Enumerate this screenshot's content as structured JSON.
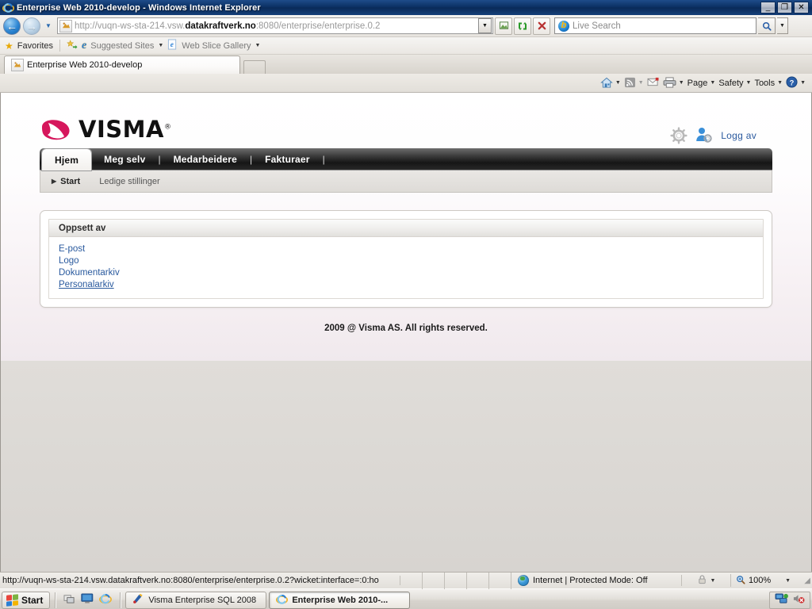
{
  "window": {
    "title": "Enterprise Web 2010-develop - Windows Internet Explorer",
    "minimize": "_",
    "restore": "❐",
    "close": "✕"
  },
  "browser": {
    "back_icon": "←",
    "forward_icon": "→",
    "recent_caret": "▼",
    "address": {
      "url_prefix": "http://vuqn-ws-sta-214.vsw.",
      "url_domain": "datakraftverk.no",
      "url_suffix": ":8080/enterprise/enterprise.0.2",
      "dropdown_caret": "▼"
    },
    "buttons": {
      "compatibility": "▧",
      "refresh": "↻",
      "stop": "✕"
    },
    "search": {
      "placeholder": "Live Search",
      "logo": "b",
      "go_icon": "⌕",
      "caret": "▼"
    },
    "favorites_bar": {
      "favorites_label": "Favorites",
      "suggested_sites_label": "Suggested Sites",
      "web_slice_label": "Web Slice Gallery",
      "caret": "▼"
    },
    "tabs": [
      {
        "label": "Enterprise Web 2010-develop"
      }
    ],
    "command_bar": [
      {
        "name": "home",
        "icon": "⌂",
        "label": "",
        "caret": "▼"
      },
      {
        "name": "feeds",
        "icon": "📶",
        "label": "",
        "caret": "▼"
      },
      {
        "name": "mail",
        "icon": "✉",
        "label": "",
        "caret": ""
      },
      {
        "name": "print",
        "icon": "🖨",
        "label": "",
        "caret": "▼"
      },
      {
        "name": "page",
        "icon": "",
        "label": "Page",
        "caret": "▼"
      },
      {
        "name": "safety",
        "icon": "",
        "label": "Safety",
        "caret": "▼"
      },
      {
        "name": "tools",
        "icon": "",
        "label": "Tools",
        "caret": "▼"
      },
      {
        "name": "help",
        "icon": "?",
        "label": "",
        "caret": "▼"
      }
    ]
  },
  "page": {
    "brand": {
      "name": "VISMA",
      "trademark": "®",
      "swoosh_color": "#d6175c"
    },
    "top_actions": {
      "settings_icon": "gear-icon",
      "user_icon": "user-settings-icon",
      "logout_label": "Logg av"
    },
    "nav_tabs": [
      {
        "label": "Hjem",
        "active": true
      },
      {
        "label": "Meg selv",
        "active": false
      },
      {
        "label": "Medarbeidere",
        "active": false
      },
      {
        "label": "Fakturaer",
        "active": false
      }
    ],
    "nav_separator": "|",
    "subnav": {
      "arrow": "▶",
      "start_label": "Start",
      "items": [
        {
          "label": "Ledige stillinger"
        }
      ]
    },
    "panel": {
      "header": "Oppsett av",
      "links": [
        {
          "label": "E-post",
          "hovered": false
        },
        {
          "label": "Logo",
          "hovered": false
        },
        {
          "label": "Dokumentarkiv",
          "hovered": false
        },
        {
          "label": "Personalarkiv",
          "hovered": true
        }
      ]
    },
    "footer": "2009 @ Visma AS. All rights reserved.",
    "link_color": "#2a5a9e"
  },
  "status_bar": {
    "url": "http://vuqn-ws-sta-214.vsw.datakraftverk.no:8080/enterprise/enterprise.0.2?wicket:interface=:0:ho",
    "zone": "Internet | Protected Mode: Off",
    "protected_icon": "🔒",
    "protected_caret": "▼",
    "zoom_level": "100%",
    "zoom_caret": "▼"
  },
  "taskbar": {
    "start_label": "Start",
    "quick_launch": [
      {
        "name": "show-desktop-icon",
        "glyph": "🗔"
      },
      {
        "name": "display-icon",
        "glyph": "🖥"
      },
      {
        "name": "internet-explorer-icon",
        "glyph": "e"
      }
    ],
    "tasks": [
      {
        "label": "Visma Enterprise SQL 2008",
        "active": false
      },
      {
        "label": "Enterprise Web 2010-...",
        "active": true
      }
    ],
    "tray": [
      {
        "name": "network-icon",
        "glyph": "🖧"
      },
      {
        "name": "volume-muted-icon",
        "glyph": "🔇"
      }
    ]
  }
}
